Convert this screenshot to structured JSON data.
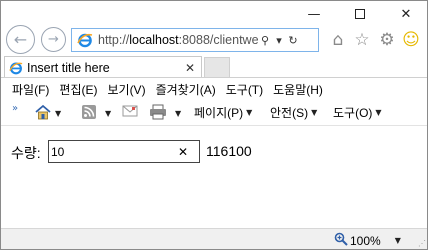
{
  "window": {
    "minimize_glyph": "—",
    "close_glyph": "✕"
  },
  "nav": {
    "back_icon": "arrow-left-icon",
    "forward_icon": "arrow-right-icon",
    "back_glyph": "←",
    "forward_glyph": "→"
  },
  "address": {
    "url_prefix": "http://",
    "url_host": "localhost",
    "url_rest": ":8088/clientwe",
    "search_glyph": "⚲",
    "dropdown_glyph": "▾",
    "refresh_glyph": "↻"
  },
  "toolbar_right": {
    "home_glyph": "⌂",
    "favorites_glyph": "☆",
    "settings_glyph": "⚙",
    "smiley_glyph": "☺"
  },
  "tab": {
    "title": "Insert title here",
    "close_glyph": "✕"
  },
  "menu": {
    "items": [
      "파일(F)",
      "편집(E)",
      "보기(V)",
      "즐겨찾기(A)",
      "도구(T)",
      "도움말(H)"
    ]
  },
  "commandbar": {
    "chevron": "»",
    "page_label": "페이지(P)",
    "safety_label": "안전(S)",
    "tools_label": "도구(O)",
    "dropdown_glyph": "▼"
  },
  "form": {
    "quantity_label": "수량:",
    "quantity_value": "10",
    "clear_glyph": "✕",
    "result": "116100"
  },
  "status": {
    "zoom": "100%",
    "zoom_dropdown": "▼",
    "grip": "⋰"
  },
  "colors": {
    "accent": "#3a6fb7",
    "address_border": "#7eb4ea"
  }
}
